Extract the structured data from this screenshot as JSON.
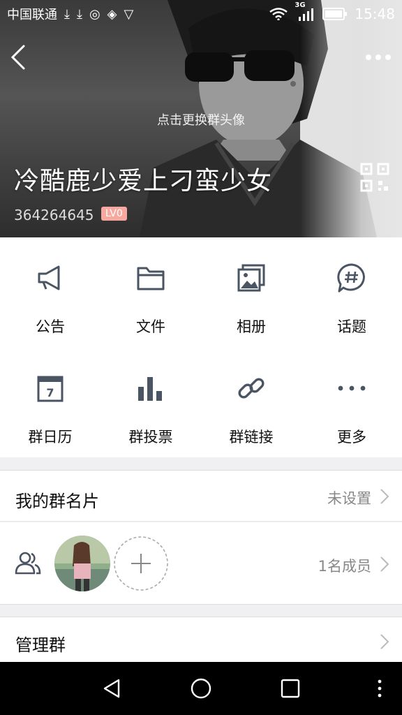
{
  "status_bar": {
    "carrier": "中国联通",
    "network": "3G",
    "time": "15:48"
  },
  "header": {
    "change_avatar_hint": "点击更换群头像",
    "group_name": "冷酷鹿少爱上刁蛮少女",
    "group_id": "364264645",
    "level": "LV0"
  },
  "grid": [
    {
      "label": "公告",
      "icon": "megaphone-icon"
    },
    {
      "label": "文件",
      "icon": "folder-icon"
    },
    {
      "label": "相册",
      "icon": "album-icon"
    },
    {
      "label": "话题",
      "icon": "topic-hash-icon"
    },
    {
      "label": "群日历",
      "icon": "calendar-icon"
    },
    {
      "label": "群投票",
      "icon": "vote-bars-icon"
    },
    {
      "label": "群链接",
      "icon": "link-icon"
    },
    {
      "label": "更多",
      "icon": "more-dots-icon"
    }
  ],
  "calendar_day": "7",
  "my_card": {
    "title": "我的群名片",
    "value": "未设置"
  },
  "members": {
    "count_text": "1名成员"
  },
  "manage": {
    "title": "管理群"
  },
  "colors": {
    "icon": "#4a5463",
    "badge": "#f7a9a0"
  }
}
